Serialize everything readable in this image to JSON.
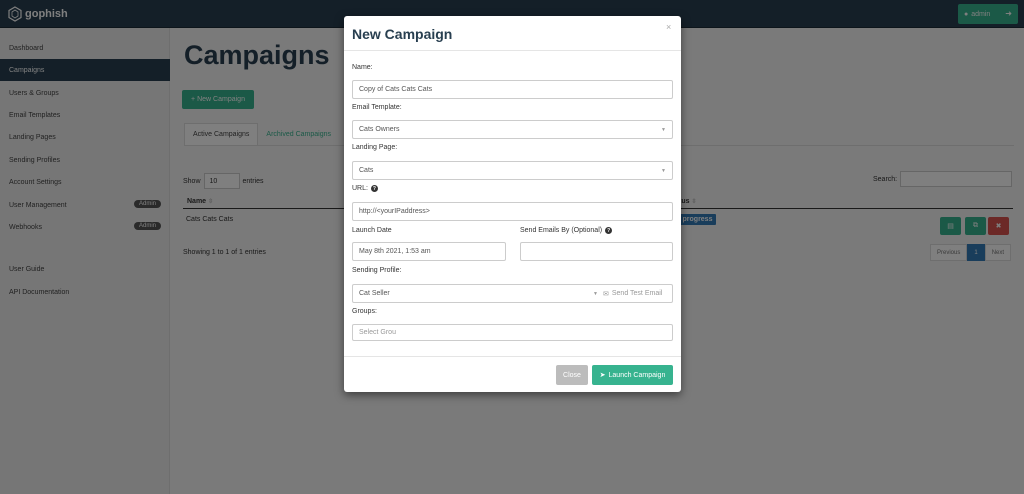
{
  "navbar": {
    "brand": "gophish",
    "user_label": "admin"
  },
  "sidebar": {
    "items": [
      {
        "label": "Dashboard"
      },
      {
        "label": "Campaigns"
      },
      {
        "label": "Users & Groups"
      },
      {
        "label": "Email Templates"
      },
      {
        "label": "Landing Pages"
      },
      {
        "label": "Sending Profiles"
      },
      {
        "label": "Account Settings"
      },
      {
        "label": "User Management",
        "badge": "Admin"
      },
      {
        "label": "Webhooks",
        "badge": "Admin"
      },
      {
        "label": "User Guide"
      },
      {
        "label": "API Documentation"
      }
    ]
  },
  "main": {
    "title": "Campaigns",
    "new_button": "New Campaign",
    "tabs": [
      {
        "label": "Active Campaigns"
      },
      {
        "label": "Archived Campaigns"
      }
    ],
    "show_label": "Show",
    "entries_value": "10",
    "entries_label": "entries",
    "search_label": "Search:",
    "columns": {
      "name": "Name",
      "status": "tus"
    },
    "rows": [
      {
        "name": "Cats Cats Cats",
        "status": "progress"
      }
    ],
    "info": "Showing 1 to 1 of 1 entries",
    "pagination": {
      "previous": "Previous",
      "current": "1",
      "next": "Next"
    }
  },
  "modal": {
    "title": "New Campaign",
    "close_glyph": "×",
    "name_label": "Name:",
    "name_value": "Copy of Cats Cats Cats",
    "template_label": "Email Template:",
    "template_value": "Cats Owners",
    "page_label": "Landing Page:",
    "page_value": "Cats",
    "url_label": "URL:",
    "url_value": "http://<yourIPaddress>",
    "launch_label": "Launch Date",
    "launch_value": "May 8th 2021, 1:53 am",
    "send_by_label": "Send Emails By (Optional)",
    "send_by_value": "",
    "profile_label": "Sending Profile:",
    "profile_value": "Cat Seller",
    "test_email": "Send Test Email",
    "groups_label": "Groups:",
    "groups_placeholder": "Select Grou",
    "close_button": "Close",
    "launch_button": "Launch Campaign"
  },
  "colors": {
    "navbar": "#283f50",
    "accent": "#37b38f",
    "primary": "#337ab7",
    "danger": "#d9534f"
  },
  "icons": [
    "gophish-logo-icon",
    "user-icon",
    "logout-icon",
    "plus-icon",
    "sort-icon",
    "chart-icon",
    "copy-icon",
    "trash-icon",
    "question-icon",
    "envelope-icon",
    "rocket-icon",
    "close-icon",
    "caret-down-icon"
  ]
}
